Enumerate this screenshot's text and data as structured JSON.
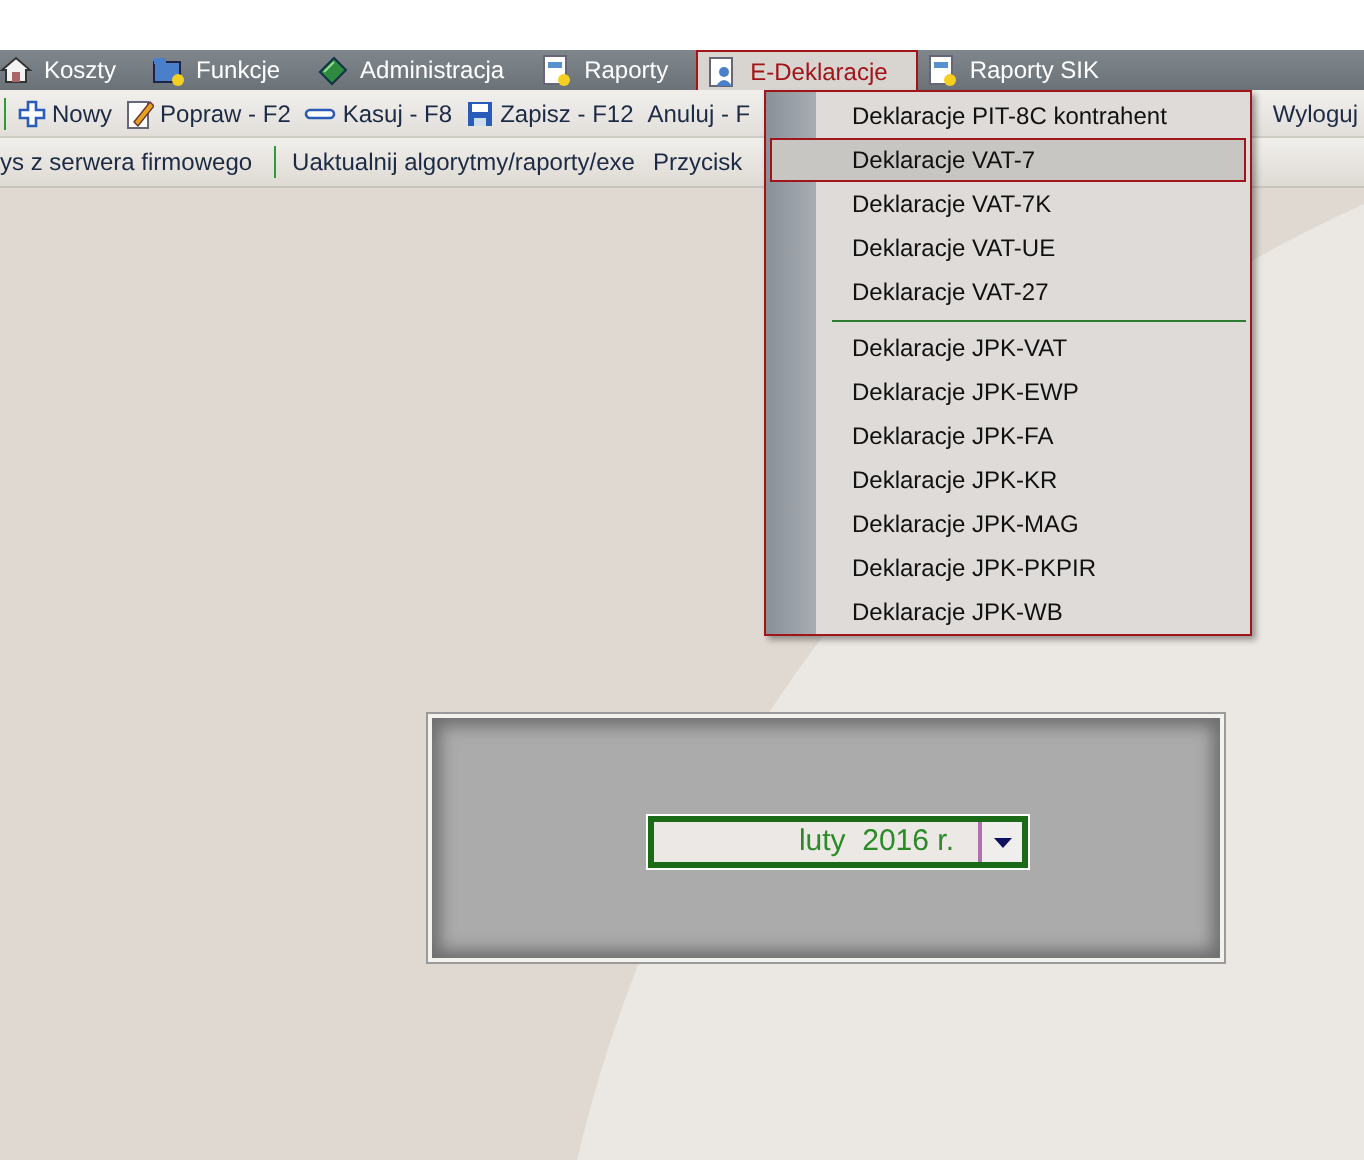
{
  "menu_bar": {
    "items": [
      {
        "label": "Koszty",
        "selected": false
      },
      {
        "label": "Funkcje",
        "selected": false
      },
      {
        "label": "Administracja",
        "selected": false
      },
      {
        "label": "Raporty",
        "selected": false
      },
      {
        "label": "E-Deklaracje",
        "selected": true
      },
      {
        "label": "Raporty SIK",
        "selected": false
      }
    ]
  },
  "toolbar": {
    "buttons": [
      {
        "label": "Nowy"
      },
      {
        "label": "Popraw - F2"
      },
      {
        "label": "Kasuj - F8"
      },
      {
        "label": "Zapisz - F12"
      },
      {
        "label": "Anuluj - F"
      }
    ],
    "right_button": {
      "label": "Wyloguj"
    }
  },
  "toolbar_2": {
    "links": [
      "ys z serwera firmowego",
      "Uaktualnij algorytmy/raporty/exe",
      "Przycisk"
    ]
  },
  "dropdown_menu": {
    "groups": [
      [
        {
          "label": "Deklaracje PIT-8C kontrahent",
          "selected": false
        },
        {
          "label": "Deklaracje VAT-7",
          "selected": true
        },
        {
          "label": "Deklaracje VAT-7K",
          "selected": false
        },
        {
          "label": "Deklaracje VAT-UE",
          "selected": false
        },
        {
          "label": "Deklaracje VAT-27",
          "selected": false
        }
      ],
      [
        {
          "label": "Deklaracje JPK-VAT",
          "selected": false
        },
        {
          "label": "Deklaracje JPK-EWP",
          "selected": false
        },
        {
          "label": "Deklaracje JPK-FA",
          "selected": false
        },
        {
          "label": "Deklaracje JPK-KR",
          "selected": false
        },
        {
          "label": "Deklaracje JPK-MAG",
          "selected": false
        },
        {
          "label": "Deklaracje JPK-PKPIR",
          "selected": false
        },
        {
          "label": "Deklaracje JPK-WB",
          "selected": false
        }
      ]
    ]
  },
  "period_panel": {
    "period_select": {
      "value": "luty  2016 r."
    }
  }
}
